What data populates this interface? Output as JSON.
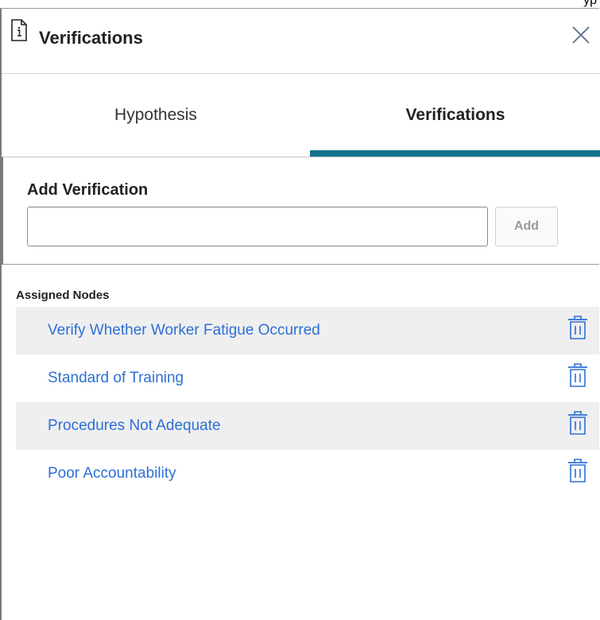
{
  "panel": {
    "title": "Verifications",
    "title_icon": "document-info-icon",
    "close_icon": "close-icon"
  },
  "tabs": [
    {
      "label": "Hypothesis",
      "active": false
    },
    {
      "label": "Verifications",
      "active": true
    }
  ],
  "add_verification": {
    "label": "Add Verification",
    "input_value": "",
    "input_placeholder": "",
    "button_label": "Add"
  },
  "assigned_nodes": {
    "label": "Assigned Nodes",
    "items": [
      {
        "label": "Verify Whether Worker Fatigue Occurred",
        "delete_icon": "trash-icon"
      },
      {
        "label": "Standard of Training",
        "delete_icon": "trash-icon"
      },
      {
        "label": "Procedures Not Adequate",
        "delete_icon": "trash-icon"
      },
      {
        "label": "Poor Accountability",
        "delete_icon": "trash-icon"
      }
    ]
  },
  "background_text": "yp",
  "colors": {
    "accent": "#14738a",
    "link": "#2e6fd6",
    "row_shade": "#efefef"
  }
}
